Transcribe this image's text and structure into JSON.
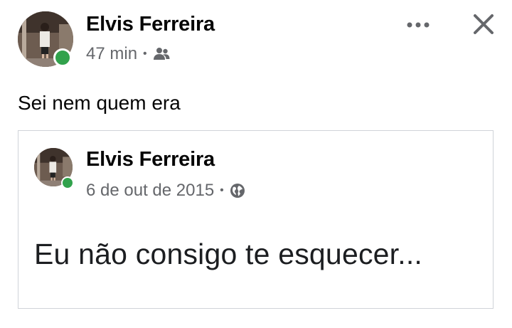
{
  "post": {
    "author": "Elvis Ferreira",
    "time": "47 min",
    "separator": "•",
    "audience_icon": "friends-icon",
    "text": "Sei nem quem era",
    "online_color": "#31a24c"
  },
  "header_actions": {
    "more_icon": "more-options-icon",
    "close_icon": "close-icon"
  },
  "shared_post": {
    "author": "Elvis Ferreira",
    "date": "6 de out de 2015",
    "separator": "•",
    "audience_icon": "globe-icon",
    "text": "Eu não consigo te esquecer..."
  },
  "colors": {
    "text_primary": "#050505",
    "text_secondary": "#65676b",
    "border": "#d0d3d8",
    "online": "#31a24c"
  }
}
